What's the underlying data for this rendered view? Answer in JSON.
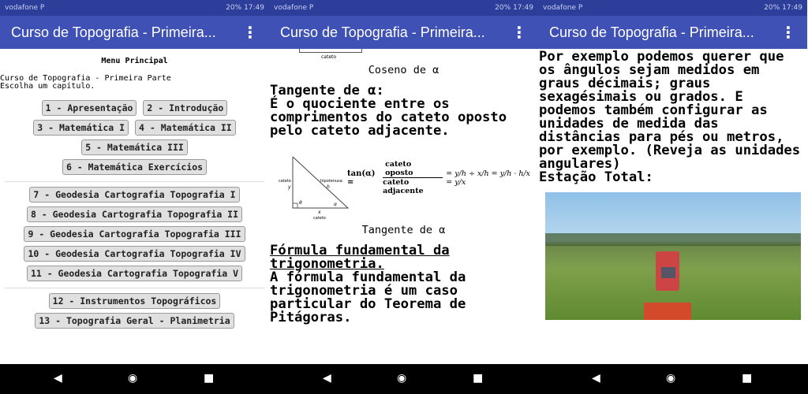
{
  "status_bar": {
    "carrier": "vodafone P",
    "battery": "20%",
    "time": "17:49"
  },
  "app_title": "Curso de Topografia - Primeira...",
  "panel1": {
    "heading": "Menu Principal",
    "intro": [
      "Curso de Topografia - Primeira Parte",
      "Escolha um capítulo."
    ],
    "buttons": [
      "1 - Apresentação",
      "2 - Introdução",
      "3 - Matemática I",
      "4 - Matemática II",
      "5 - Matemática III",
      "6 - Matemática Exercícios",
      "7 - Geodesia Cartografia Topografia I",
      "8 - Geodesia Cartografia Topografia II",
      "9 - Geodesia Cartografia Topografia III",
      "10 - Geodesia Cartografia Topografia IV",
      "11 - Geodesia Cartografia Topografia V",
      "12 - Instrumentos Topográficos",
      "13 - Topografia Geral - Planimetria"
    ]
  },
  "panel2": {
    "fig_top_label": "cateto",
    "caption_cos": "Coseno de α",
    "tan_title": "Tangente de α:",
    "tan_text": "É o quociente entre os comprimentos do cateto oposto pelo cateto adjacente.",
    "formula": {
      "lhs": "tan(α) =",
      "num": "cateto oposto",
      "den": "cateto adjacente",
      "rest": "= y/h ÷ x/h = y/h · h/x = y/x",
      "tri_labels": {
        "side_left": "cateto",
        "y": "y",
        "hyp": "hipotenusa",
        "h": "h",
        "x": "x",
        "bottom": "cateto",
        "angle": "α",
        "theta": "θ"
      }
    },
    "caption_tan": "Tangente de α",
    "fund_title": "Fórmula fundamental da trigonometria.",
    "fund_text": "A fórmula fundamental da trigonometria é um caso particular do Teorema de Pitágoras."
  },
  "panel3": {
    "text": "Por exemplo podemos querer que os ângulos sejam medidos em graus décimais; graus sexagésimais ou grados. E podemos também configurar as unidades de medida das distâncias para pés ou metros, por exemplo. (Reveja as unidades angulares)",
    "station_label": "Estação Total:"
  }
}
